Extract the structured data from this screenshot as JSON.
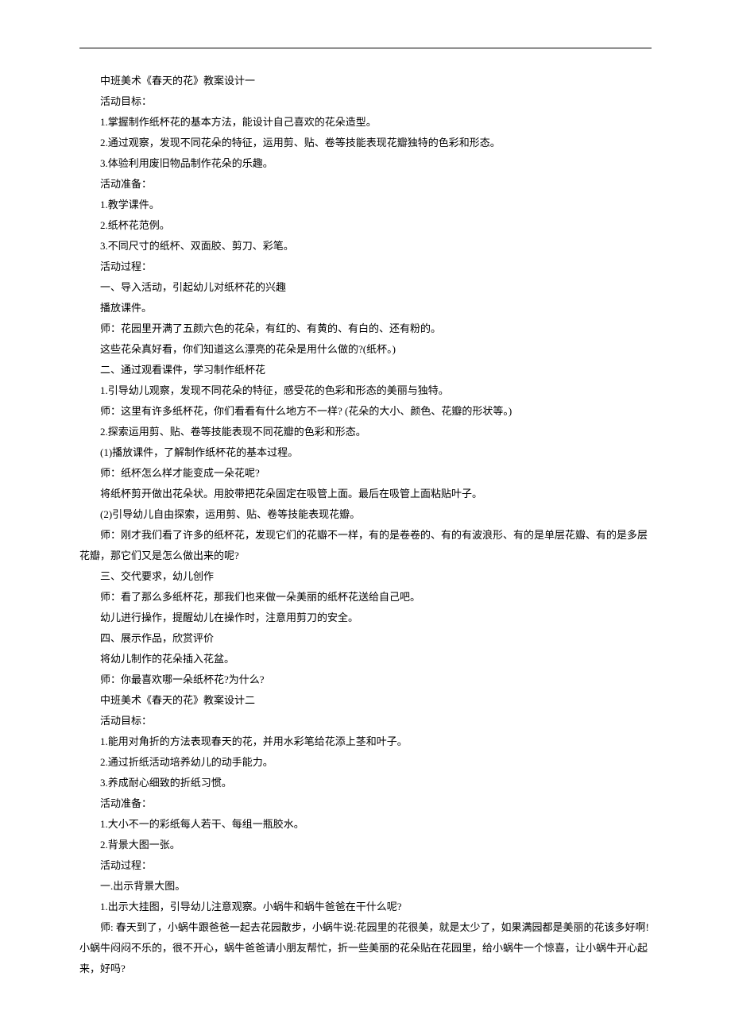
{
  "lines": [
    "中班美术《春天的花》教案设计一",
    "活动目标：",
    "1.掌握制作纸杯花的基本方法，能设计自己喜欢的花朵造型。",
    "2.通过观察，发现不同花朵的特征，运用剪、贴、卷等技能表现花瓣独特的色彩和形态。",
    "3.体验利用废旧物品制作花朵的乐趣。",
    "活动准备：",
    "1.教学课件。",
    "2.纸杯花范例。",
    "3.不同尺寸的纸杯、双面胶、剪刀、彩笔。",
    "活动过程：",
    "一、导入活动，引起幼儿对纸杯花的兴趣",
    "播放课件。",
    "师：花园里开满了五颜六色的花朵，有红的、有黄的、有白的、还有粉的。",
    "这些花朵真好看，你们知道这么漂亮的花朵是用什么做的?(纸杯。)",
    "二、通过观看课件，学习制作纸杯花",
    "1.引导幼儿观察，发现不同花朵的特征，感受花的色彩和形态的美丽与独特。",
    "师：这里有许多纸杯花，你们看看有什么地方不一样? (花朵的大小、颜色、花瓣的形状等。)",
    "2.探索运用剪、贴、卷等技能表现不同花瓣的色彩和形态。",
    "(1)播放课件，了解制作纸杯花的基本过程。",
    "师：纸杯怎么样才能变成一朵花呢?",
    "将纸杯剪开做出花朵状。用胶带把花朵固定在吸管上面。最后在吸管上面粘贴叶子。",
    "(2)引导幼儿自由探索，运用剪、贴、卷等技能表现花瓣。"
  ],
  "longParagraph1": "师：刚才我们看了许多的纸杯花，发现它们的花瓣不一样，有的是卷卷的、有的有波浪形、有的是单层花瓣、有的是多层花瓣，那它们又是怎么做出来的呢?",
  "lines2": [
    "三、交代要求，幼儿创作",
    "师：看了那么多纸杯花，那我们也来做一朵美丽的纸杯花送给自己吧。",
    "幼儿进行操作，提醒幼儿在操作时，注意用剪刀的安全。",
    "四、展示作品，欣赏评价",
    "将幼儿制作的花朵插入花盆。",
    "师：你最喜欢哪一朵纸杯花?为什么?",
    "中班美术《春天的花》教案设计二",
    "活动目标：",
    "1.能用对角折的方法表现春天的花，并用水彩笔给花添上茎和叶子。",
    "2.通过折纸活动培养幼儿的动手能力。",
    "3.养成耐心细致的折纸习惯。",
    "活动准备：",
    "1.大小不一的彩纸每人若干、每组一瓶胶水。",
    "2.背景大图一张。",
    "活动过程：",
    "一.出示背景大图。",
    "1.出示大挂图，引导幼儿注意观察。小蜗牛和蜗牛爸爸在干什么呢?"
  ],
  "longParagraph2": "师: 春天到了，小蜗牛跟爸爸一起去花园散步，小蜗牛说:花园里的花很美，就是太少了，如果满园都是美丽的花该多好啊!小蜗牛闷闷不乐的，很不开心，蜗牛爸爸请小朋友帮忙，折一些美丽的花朵贴在花园里，给小蜗牛一个惊喜，让小蜗牛开心起来，好吗?"
}
